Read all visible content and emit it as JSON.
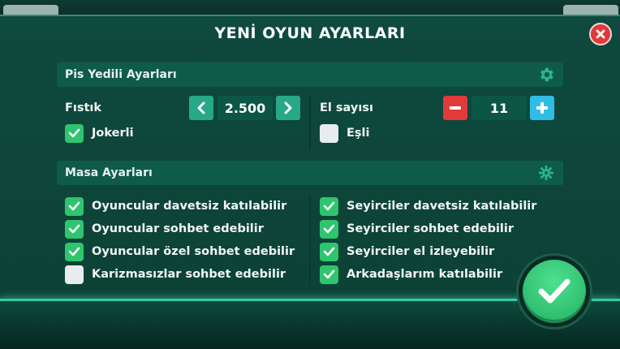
{
  "dialog": {
    "title": "YENİ OYUN AYARLARI",
    "close_icon": "close-icon",
    "confirm_icon": "check-icon"
  },
  "game_settings": {
    "header": "Pis Yedili Ayarları",
    "header_icon": "gear-icon",
    "fistik": {
      "label": "Fıstık",
      "value": "2.500"
    },
    "el_sayisi": {
      "label": "El sayısı",
      "value": "11"
    },
    "jokerli": {
      "label": "Jokerli",
      "checked": true
    },
    "esli": {
      "label": "Eşli",
      "checked": false
    }
  },
  "table_settings": {
    "header": "Masa Ayarları",
    "header_icon": "gear-icon",
    "left": [
      {
        "label": "Oyuncular davetsiz katılabilir",
        "checked": true
      },
      {
        "label": "Oyuncular sohbet edebilir",
        "checked": true
      },
      {
        "label": "Oyuncular özel sohbet edebilir",
        "checked": true
      },
      {
        "label": "Karizmasızlar sohbet edebilir",
        "checked": false
      }
    ],
    "right": [
      {
        "label": "Seyirciler davetsiz katılabilir",
        "checked": true
      },
      {
        "label": "Seyirciler sohbet edebilir",
        "checked": true
      },
      {
        "label": "Seyirciler el izleyebilir",
        "checked": true
      },
      {
        "label": "Arkadaşlarım katılabilir",
        "checked": true
      }
    ]
  },
  "colors": {
    "accent_green": "#2ec56e",
    "close_red": "#e03a3a",
    "plus_blue": "#2fbde8",
    "panel": "#0f5b49"
  }
}
